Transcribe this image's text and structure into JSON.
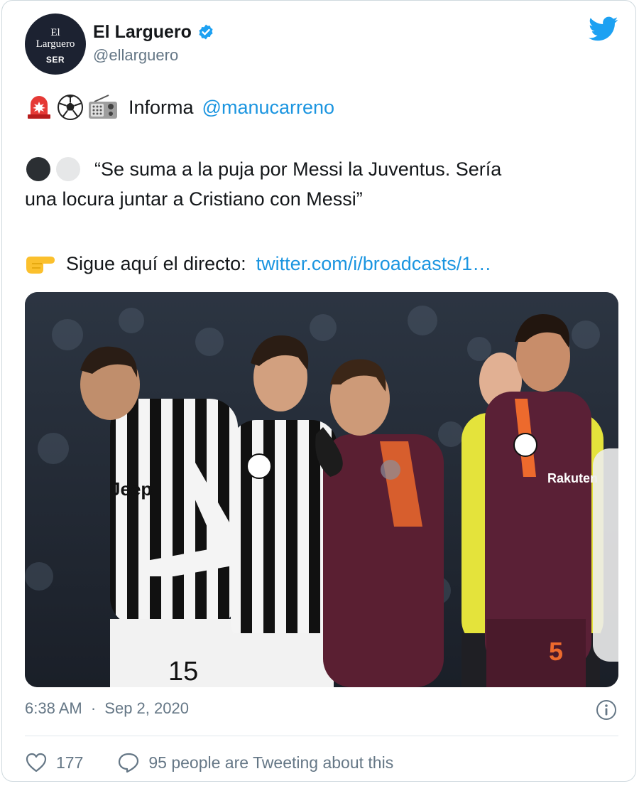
{
  "account": {
    "avatar_text_line1": "El",
    "avatar_text_line2": "Larguero",
    "avatar_text_line3": "SER",
    "name": "El Larguero",
    "handle": "@ellarguero"
  },
  "tweet": {
    "line1_text": "Informa",
    "line1_mention": "@manucarreno",
    "line2": "“Se suma a la puja por Messi la Juventus. Sería",
    "line3": "una locura juntar a Cristiano con Messi”",
    "line4_text": "Sigue aquí el directo:",
    "line4_link": "twitter.com/i/broadcasts/1…",
    "emojis": [
      "rotating-light-icon",
      "soccer-ball-icon",
      "radio-icon",
      "black-circle-icon",
      "white-circle-icon",
      "pointing-right-icon"
    ]
  },
  "media": {
    "jersey_number_left": "15",
    "jersey_number_right": "5",
    "kit_text_left": "Jeep",
    "kit_text_right": "Rakuten"
  },
  "meta": {
    "time": "6:38 AM",
    "separator": "·",
    "date": "Sep 2, 2020"
  },
  "actions": {
    "likes": "177",
    "comments_label": "95 people are Tweeting about this"
  },
  "colors": {
    "link": "#1b95e0",
    "muted": "#657786",
    "verified": "#1da1f2"
  }
}
